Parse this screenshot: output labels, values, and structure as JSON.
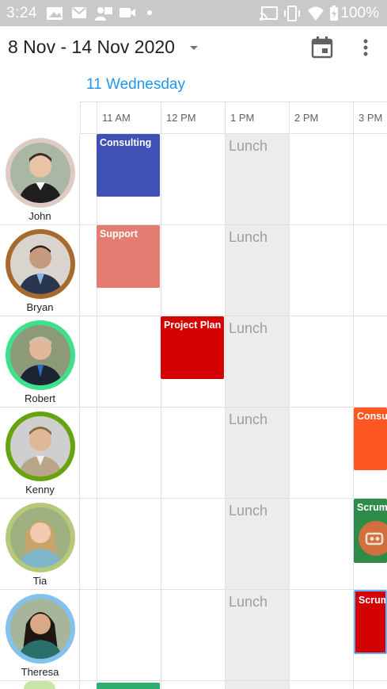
{
  "status_bar": {
    "time": "3:24",
    "battery_percent": "100%",
    "icons_left": [
      "photo-icon",
      "gmail-icon",
      "cast-icon",
      "video-icon",
      "dot-icon"
    ],
    "icons_right": [
      "cast-connected-icon",
      "vibrate-icon",
      "wifi-icon",
      "battery-charging-icon"
    ]
  },
  "app_bar": {
    "title": "8 Nov - 14 Nov 2020",
    "icons": [
      "dropdown-caret-icon",
      "calendar-icon",
      "more-vert-icon"
    ]
  },
  "day_header": {
    "label": "11 Wednesday",
    "color": "#2196f3"
  },
  "time_slots": [
    "11 AM",
    "12 PM",
    "1 PM",
    "2 PM",
    "3 PM"
  ],
  "lunch_label": "Lunch",
  "resources": [
    {
      "name": "John",
      "ring_color": "#e0cbc4"
    },
    {
      "name": "Bryan",
      "ring_color": "#a86a2c"
    },
    {
      "name": "Robert",
      "ring_color": "#3ee08c"
    },
    {
      "name": "Kenny",
      "ring_color": "#66a30f"
    },
    {
      "name": "Tia",
      "ring_color": "#b6c97a"
    },
    {
      "name": "Theresa",
      "ring_color": "#82c2ec"
    }
  ],
  "appointments": [
    {
      "label": "Consulting",
      "resource": "John",
      "color": "#3f51b5"
    },
    {
      "label": "Support",
      "resource": "Bryan",
      "color": "#e57c72"
    },
    {
      "label": "Project Plan",
      "resource": "Robert",
      "color": "#d50000"
    },
    {
      "label": "Consu",
      "resource": "Kenny",
      "color": "#ff5722"
    },
    {
      "label": "Scrum",
      "resource": "Tia",
      "color": "#2e8b4a"
    },
    {
      "label": "Scrum",
      "resource": "Theresa",
      "color": "#d50000"
    }
  ]
}
